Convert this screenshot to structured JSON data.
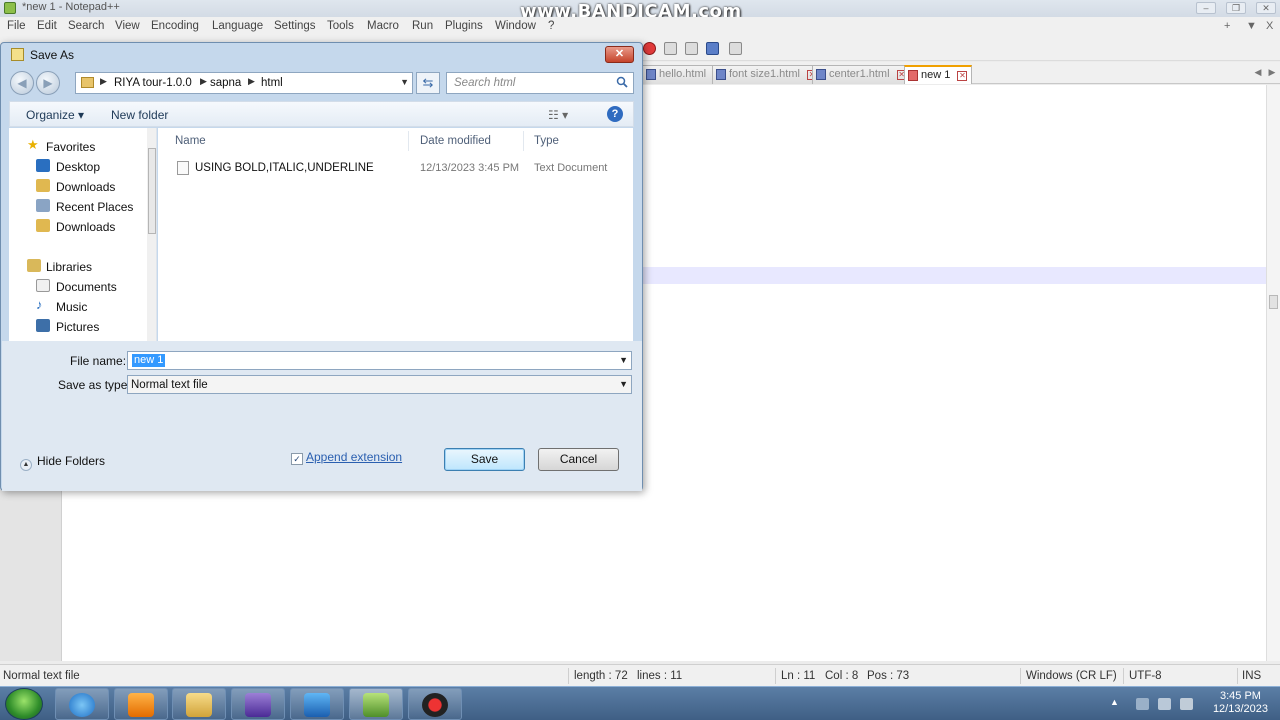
{
  "npp": {
    "title": "*new 1 - Notepad++",
    "watermark": "www.BANDICAM.com",
    "menu": [
      "File",
      "Edit",
      "Search",
      "View",
      "Encoding",
      "Language",
      "Settings",
      "Tools",
      "Macro",
      "Run",
      "Plugins",
      "Window",
      "?"
    ],
    "menu_right_plus": "+",
    "menu_right_down": "▼",
    "menu_right_x": "X",
    "tabs": [
      {
        "label": "hello.html",
        "active": false
      },
      {
        "label": "font size1.html",
        "active": false
      },
      {
        "label": "center1.html",
        "active": false
      },
      {
        "label": "new 1",
        "active": true
      }
    ],
    "status": {
      "type": "Normal text file",
      "length": "length : 72",
      "lines": "lines : 11",
      "ln": "Ln : 11",
      "col": "Col : 8",
      "pos": "Pos : 73",
      "eol": "Windows (CR LF)",
      "encoding": "UTF-8",
      "mode": "INS"
    }
  },
  "dialog": {
    "title": "Save As",
    "close": "✕",
    "breadcrumb": [
      "RIYA tour-1.0.0",
      "sapna",
      "html"
    ],
    "search_placeholder": "Search html",
    "toolbar": {
      "organize": "Organize ▾",
      "new_folder": "New folder"
    },
    "nav": {
      "favorites": "Favorites",
      "items": [
        "Desktop",
        "Downloads",
        "Recent Places",
        "Downloads"
      ],
      "libraries": "Libraries",
      "lib_items": [
        "Documents",
        "Music",
        "Pictures"
      ]
    },
    "columns": {
      "name": "Name",
      "date": "Date modified",
      "type": "Type"
    },
    "files": [
      {
        "name": "USING BOLD,ITALIC,UNDERLINE",
        "date": "12/13/2023 3:45 PM",
        "type": "Text Document"
      }
    ],
    "file_name_label": "File name:",
    "file_name_value": "new 1",
    "save_type_label": "Save as type:",
    "save_type_value": "Normal text file",
    "hide_folders": "Hide Folders",
    "append_extension": "Append extension",
    "append_checked": "✓",
    "save": "Save",
    "cancel": "Cancel"
  },
  "taskbar": {
    "time": "3:45 PM",
    "date": "12/13/2023"
  }
}
